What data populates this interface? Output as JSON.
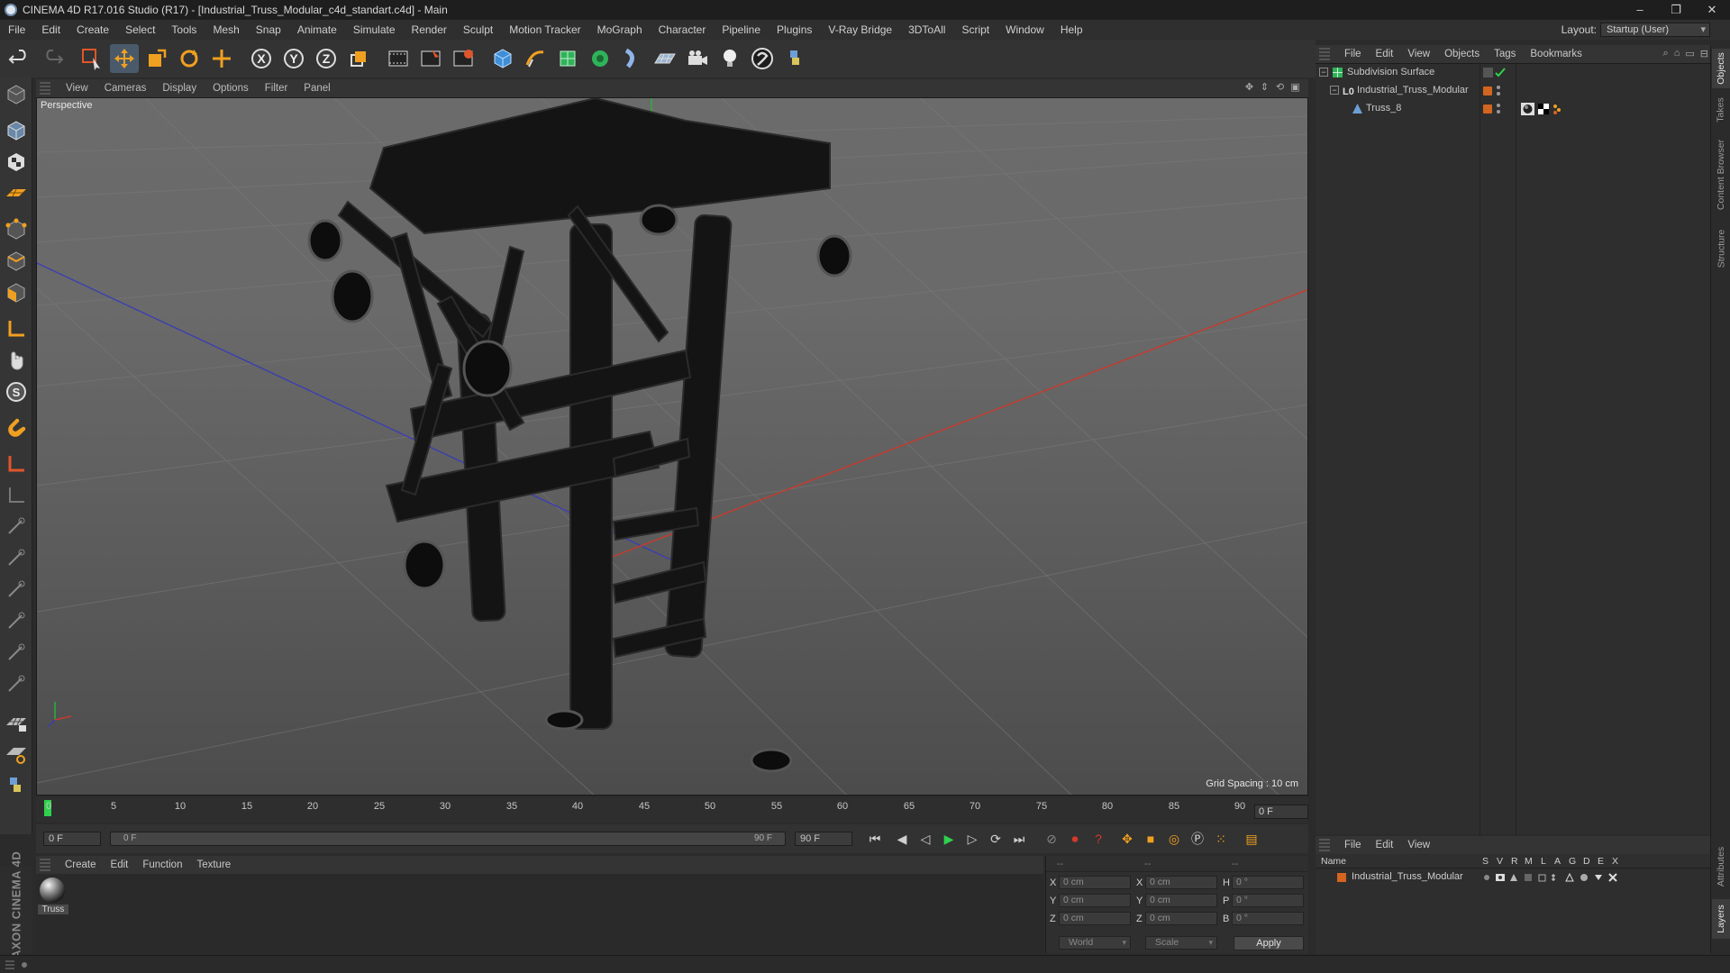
{
  "window": {
    "title": "CINEMA 4D R17.016 Studio (R17) - [Industrial_Truss_Modular_c4d_standart.c4d] - Main",
    "controls": [
      "–",
      "❐",
      "✕"
    ]
  },
  "menubar": {
    "items": [
      "File",
      "Edit",
      "Create",
      "Select",
      "Tools",
      "Mesh",
      "Snap",
      "Animate",
      "Simulate",
      "Render",
      "Sculpt",
      "Motion Tracker",
      "MoGraph",
      "Character",
      "Pipeline",
      "Plugins",
      "V-Ray Bridge",
      "3DToAll",
      "Script",
      "Window",
      "Help"
    ],
    "layout_label": "Layout:",
    "layout_value": "Startup (User)"
  },
  "toolbar": {
    "icons": [
      "undo-icon",
      "redo-icon",
      "live-selection-icon",
      "move-icon",
      "scale-icon",
      "rotate-icon",
      "transform-icon",
      "x-axis-icon",
      "y-axis-icon",
      "z-axis-icon",
      "world-coordinates-icon",
      "render-view-icon",
      "render-picture-viewer-icon",
      "render-settings-icon",
      "cube-icon",
      "pen-icon",
      "subdivision-icon",
      "cloner-icon",
      "deformer-icon",
      "floor-icon",
      "camera-icon",
      "light-icon",
      "vray-icon",
      "python-icon"
    ]
  },
  "viewport": {
    "menu": [
      "View",
      "Cameras",
      "Display",
      "Options",
      "Filter",
      "Panel"
    ],
    "label": "Perspective",
    "grid_spacing": "Grid Spacing : 10 cm"
  },
  "timeline": {
    "ticks": [
      "0",
      "5",
      "10",
      "15",
      "20",
      "25",
      "30",
      "35",
      "40",
      "45",
      "50",
      "55",
      "60",
      "65",
      "70",
      "75",
      "80",
      "85",
      "90"
    ],
    "current_frame": 0,
    "frame_end_field": "0 F"
  },
  "transport": {
    "start_field": "0 F",
    "slider_start": "0 F",
    "slider_end": "90 F",
    "end_field": "90 F"
  },
  "material_manager": {
    "menu": [
      "Create",
      "Edit",
      "Function",
      "Texture"
    ],
    "materials": [
      {
        "name": "Truss"
      }
    ]
  },
  "coordinates": {
    "headers": [
      "--",
      "--",
      "--"
    ],
    "rows": [
      {
        "axis": "X",
        "pos": "0 cm",
        "size_axis": "X",
        "size": "0 cm",
        "rot_axis": "H",
        "rot": "0 °"
      },
      {
        "axis": "Y",
        "pos": "0 cm",
        "size_axis": "Y",
        "size": "0 cm",
        "rot_axis": "P",
        "rot": "0 °"
      },
      {
        "axis": "Z",
        "pos": "0 cm",
        "size_axis": "Z",
        "size": "0 cm",
        "rot_axis": "B",
        "rot": "0 °"
      }
    ],
    "mode": "World",
    "scale_mode": "Scale",
    "apply_label": "Apply"
  },
  "object_manager": {
    "menu": [
      "File",
      "Edit",
      "View",
      "Objects",
      "Tags",
      "Bookmarks"
    ],
    "objects": [
      {
        "name": "Subdivision Surface",
        "icon": "subdivision-surface-icon"
      },
      {
        "name": "Industrial_Truss_Modular",
        "icon": "null-object-icon"
      },
      {
        "name": "Truss_8",
        "icon": "polygon-object-icon"
      }
    ]
  },
  "side_tabs": [
    "Objects",
    "Takes",
    "Content Browser",
    "Structure",
    "Attributes",
    "Layers"
  ],
  "layer_manager": {
    "menu": [
      "File",
      "Edit",
      "View"
    ],
    "columns": [
      "Name",
      "S",
      "V",
      "R",
      "M",
      "L",
      "A",
      "G",
      "D",
      "E",
      "X"
    ],
    "layers": [
      {
        "name": "Industrial_Truss_Modular",
        "color": "#d4651e"
      }
    ]
  },
  "colors": {
    "accent_orange": "#d4651e",
    "playhead_green": "#2fd24c",
    "axis_red": "#c83a2c",
    "axis_blue": "#3b3fb0",
    "axis_green": "#27b33a"
  }
}
